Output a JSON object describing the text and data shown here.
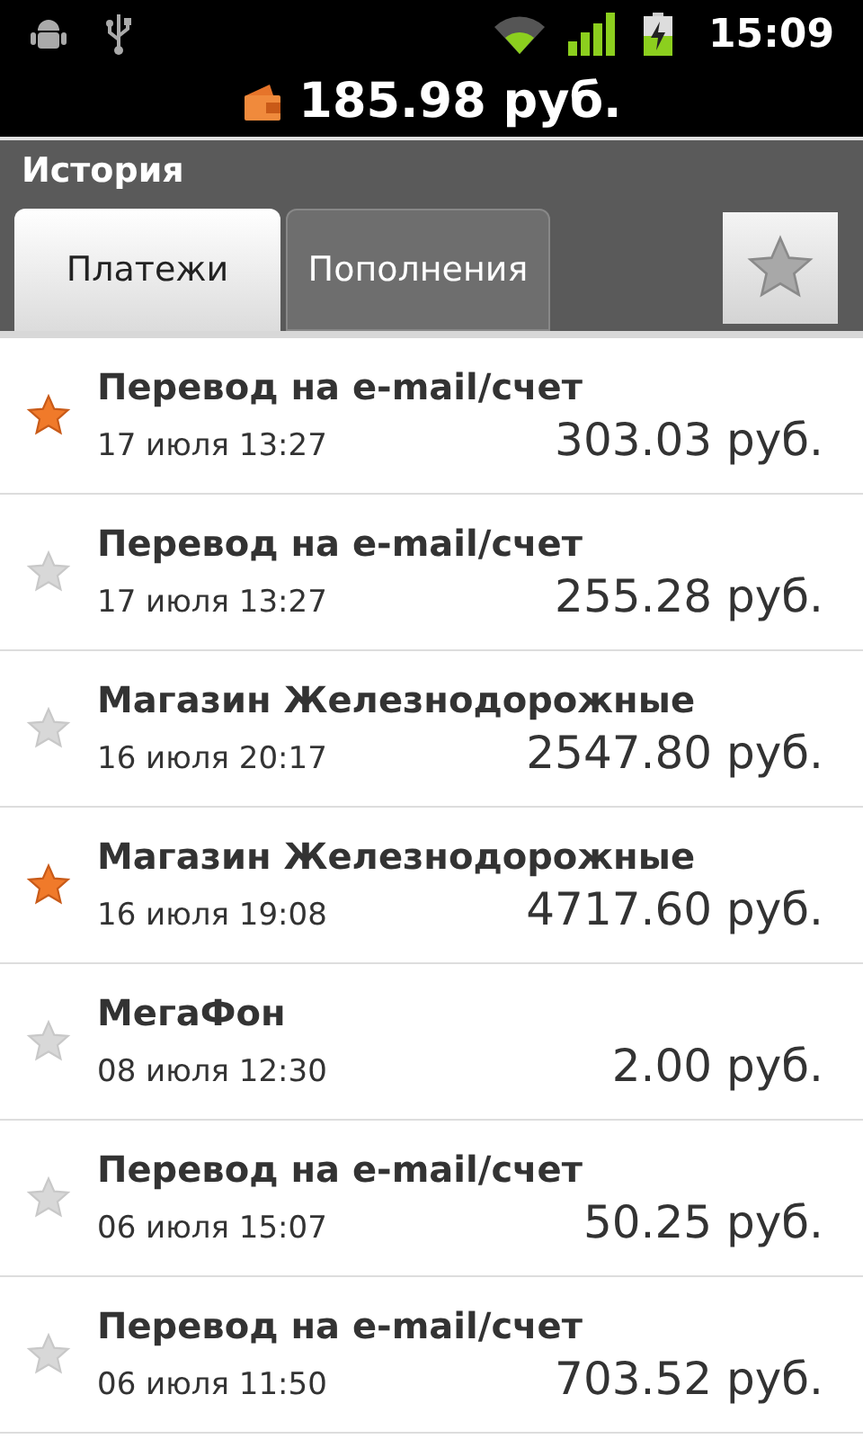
{
  "status_bar": {
    "time": "15:09"
  },
  "balance": {
    "amount": "185.98 руб."
  },
  "section": {
    "title": "История"
  },
  "tabs": [
    {
      "label": "Платежи",
      "selected": true
    },
    {
      "label": "Пополнения",
      "selected": false
    }
  ],
  "favorites_filter": {
    "on": false
  },
  "payments": [
    {
      "title": "Перевод на e-mail/счет",
      "date": "17 июля 13:27",
      "amount": "303.03 руб.",
      "favorite": true
    },
    {
      "title": "Перевод на e-mail/счет",
      "date": "17 июля 13:27",
      "amount": "255.28 руб.",
      "favorite": false
    },
    {
      "title": "Магазин Железнодорожные",
      "date": "16 июля 20:17",
      "amount": "2547.80 руб.",
      "favorite": false
    },
    {
      "title": "Магазин Железнодорожные",
      "date": "16 июля 19:08",
      "amount": "4717.60 руб.",
      "favorite": true
    },
    {
      "title": "МегаФон",
      "date": "08 июля 12:30",
      "amount": "2.00 руб.",
      "favorite": false
    },
    {
      "title": "Перевод на e-mail/счет",
      "date": "06 июля 15:07",
      "amount": "50.25 руб.",
      "favorite": false
    },
    {
      "title": "Перевод на e-mail/счет",
      "date": "06 июля 11:50",
      "amount": "703.52 руб.",
      "favorite": false
    }
  ]
}
